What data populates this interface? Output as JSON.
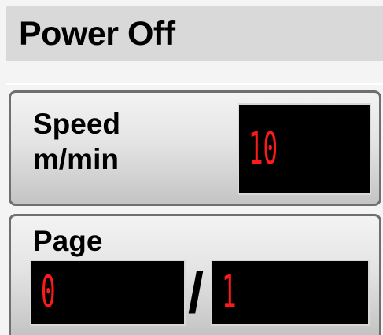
{
  "header": {
    "title": "Power Off"
  },
  "speed": {
    "label": "Speed",
    "unit": "m/min",
    "value": "10"
  },
  "page": {
    "label": "Page",
    "current": "0",
    "separator": "/",
    "total": "1"
  }
}
